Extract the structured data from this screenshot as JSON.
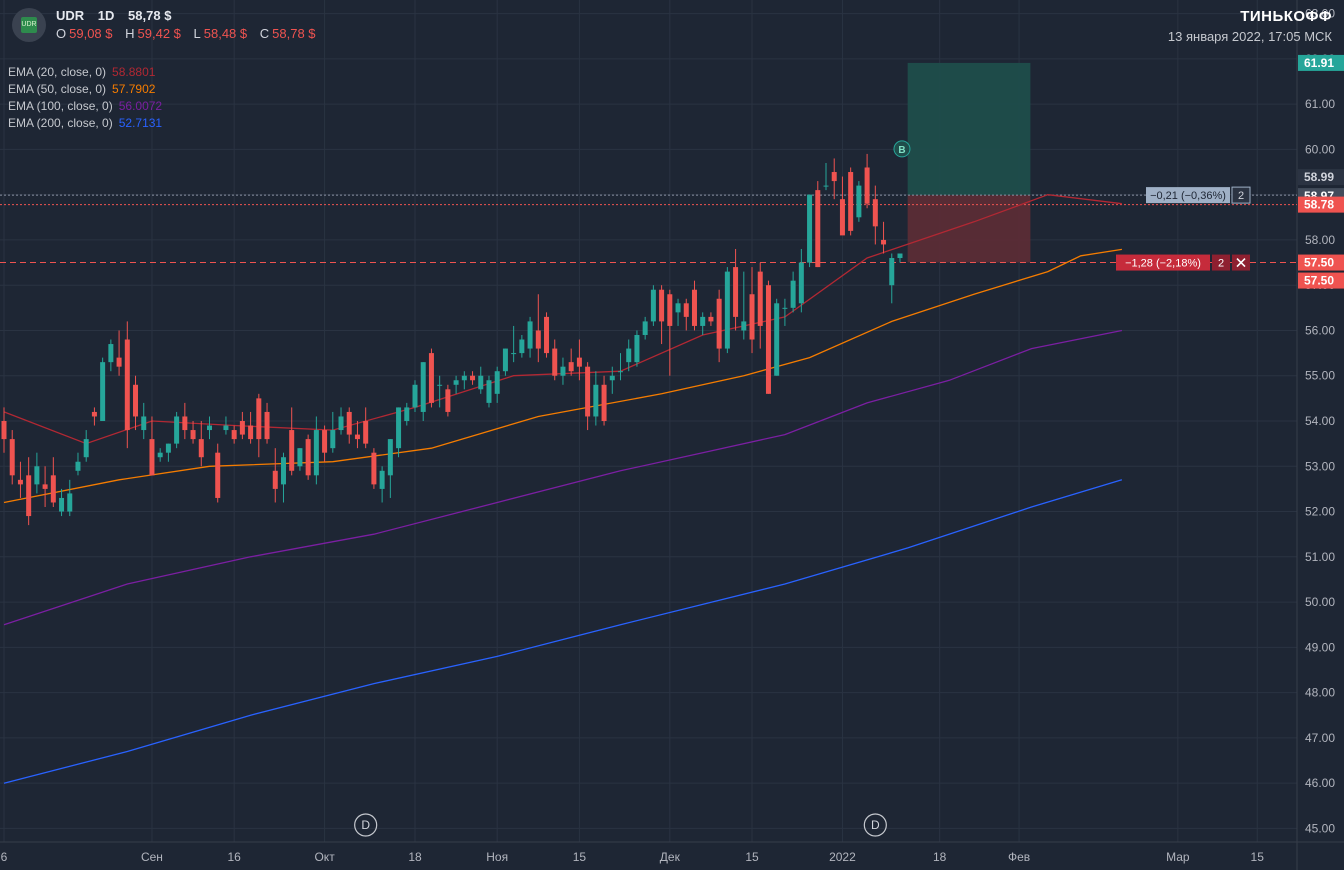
{
  "header": {
    "symbol": "UDR",
    "interval": "1D",
    "price": "58,78 $",
    "ohlc": [
      {
        "label": "O",
        "value": "59,08 $"
      },
      {
        "label": "H",
        "value": "59,42 $"
      },
      {
        "label": "L",
        "value": "58,48 $"
      },
      {
        "label": "C",
        "value": "58,78 $"
      }
    ],
    "logo_text": "UDR"
  },
  "brand": {
    "name": "ТИНЬКОФФ",
    "datetime": "13 января 2022, 17:05 МСК"
  },
  "indicators": [
    {
      "label": "EMA (20, close, 0)",
      "value": "58.8801",
      "color": "#b22833"
    },
    {
      "label": "EMA (50, close, 0)",
      "value": "57.7902",
      "color": "#f57c00"
    },
    {
      "label": "EMA (100, close, 0)",
      "value": "56.0072",
      "color": "#7b1fa2"
    },
    {
      "label": "EMA (200, close, 0)",
      "value": "52.7131",
      "color": "#2962ff"
    }
  ],
  "colors": {
    "background": "#1e2634",
    "grid": "#2a3342",
    "up": "#26a69a",
    "down": "#ef5350",
    "target_zone": "#1f4d4b",
    "stop_zone": "#5b2c36"
  },
  "chart_data": {
    "type": "candlestick",
    "ylim": [
      44.7,
      63.3
    ],
    "y_ticks": [
      "63.00",
      "62.00",
      "61.00",
      "60.00",
      "59.00",
      "58.00",
      "57.00",
      "56.00",
      "55.00",
      "54.00",
      "53.00",
      "52.00",
      "51.00",
      "50.00",
      "49.00",
      "48.00",
      "47.00",
      "46.00",
      "45.00"
    ],
    "x_ticks": [
      "6",
      "Сен",
      "16",
      "Окт",
      "18",
      "Ноя",
      "15",
      "Дек",
      "15",
      "2022",
      "18",
      "Фев",
      "Мар",
      "15"
    ],
    "x_tick_dates": [
      "2021-08-06",
      "2021-09-01",
      "2021-09-16",
      "2021-10-01",
      "2021-10-18",
      "2021-11-01",
      "2021-11-15",
      "2021-12-01",
      "2021-12-15",
      "2022-01-01",
      "2022-01-18",
      "2022-02-01",
      "2022-03-01",
      "2022-03-15"
    ],
    "candles": [
      {
        "date": "2021-08-06",
        "o": 54.0,
        "h": 54.3,
        "l": 53.3,
        "c": 53.6
      },
      {
        "date": "2021-08-09",
        "o": 53.6,
        "h": 53.8,
        "l": 52.6,
        "c": 52.8
      },
      {
        "date": "2021-08-10",
        "o": 52.7,
        "h": 53.1,
        "l": 52.3,
        "c": 52.6
      },
      {
        "date": "2021-08-11",
        "o": 52.8,
        "h": 53.2,
        "l": 51.7,
        "c": 51.9
      },
      {
        "date": "2021-08-12",
        "o": 52.6,
        "h": 53.3,
        "l": 52.4,
        "c": 53.0
      },
      {
        "date": "2021-08-13",
        "o": 52.6,
        "h": 53.0,
        "l": 52.1,
        "c": 52.5
      },
      {
        "date": "2021-08-16",
        "o": 52.8,
        "h": 53.2,
        "l": 52.1,
        "c": 52.2
      },
      {
        "date": "2021-08-17",
        "o": 52.0,
        "h": 52.5,
        "l": 51.9,
        "c": 52.3
      },
      {
        "date": "2021-08-18",
        "o": 52.0,
        "h": 52.7,
        "l": 51.9,
        "c": 52.4
      },
      {
        "date": "2021-08-19",
        "o": 52.9,
        "h": 53.3,
        "l": 52.8,
        "c": 53.1
      },
      {
        "date": "2021-08-20",
        "o": 53.2,
        "h": 53.8,
        "l": 53.1,
        "c": 53.6
      },
      {
        "date": "2021-08-23",
        "o": 54.2,
        "h": 54.3,
        "l": 53.9,
        "c": 54.1
      },
      {
        "date": "2021-08-24",
        "o": 54.0,
        "h": 55.4,
        "l": 54.0,
        "c": 55.3
      },
      {
        "date": "2021-08-25",
        "o": 55.3,
        "h": 55.8,
        "l": 55.1,
        "c": 55.7
      },
      {
        "date": "2021-08-26",
        "o": 55.4,
        "h": 56.0,
        "l": 55.0,
        "c": 55.2
      },
      {
        "date": "2021-08-27",
        "o": 55.8,
        "h": 56.2,
        "l": 53.4,
        "c": 53.8
      },
      {
        "date": "2021-08-30",
        "o": 54.8,
        "h": 55.0,
        "l": 53.8,
        "c": 54.1
      },
      {
        "date": "2021-08-31",
        "o": 53.8,
        "h": 54.4,
        "l": 53.6,
        "c": 54.1
      },
      {
        "date": "2021-09-01",
        "o": 53.6,
        "h": 54.1,
        "l": 52.8,
        "c": 52.8
      },
      {
        "date": "2021-09-02",
        "o": 53.2,
        "h": 53.4,
        "l": 53.1,
        "c": 53.3
      },
      {
        "date": "2021-09-03",
        "o": 53.3,
        "h": 53.5,
        "l": 53.1,
        "c": 53.5
      },
      {
        "date": "2021-09-07",
        "o": 53.5,
        "h": 54.2,
        "l": 53.4,
        "c": 54.1
      },
      {
        "date": "2021-09-08",
        "o": 54.1,
        "h": 54.4,
        "l": 53.6,
        "c": 53.8
      },
      {
        "date": "2021-09-09",
        "o": 53.8,
        "h": 54.0,
        "l": 53.5,
        "c": 53.6
      },
      {
        "date": "2021-09-10",
        "o": 53.6,
        "h": 54.0,
        "l": 53.0,
        "c": 53.2
      },
      {
        "date": "2021-09-13",
        "o": 53.8,
        "h": 54.1,
        "l": 53.6,
        "c": 53.9
      },
      {
        "date": "2021-09-14",
        "o": 53.3,
        "h": 53.5,
        "l": 52.2,
        "c": 52.3
      },
      {
        "date": "2021-09-15",
        "o": 53.8,
        "h": 54.1,
        "l": 53.7,
        "c": 53.9
      },
      {
        "date": "2021-09-16",
        "o": 53.8,
        "h": 53.9,
        "l": 53.5,
        "c": 53.6
      },
      {
        "date": "2021-09-17",
        "o": 54.0,
        "h": 54.2,
        "l": 53.6,
        "c": 53.7
      },
      {
        "date": "2021-09-20",
        "o": 53.9,
        "h": 54.2,
        "l": 53.5,
        "c": 53.6
      },
      {
        "date": "2021-09-21",
        "o": 54.5,
        "h": 54.6,
        "l": 53.2,
        "c": 53.6
      },
      {
        "date": "2021-09-22",
        "o": 54.2,
        "h": 54.4,
        "l": 53.5,
        "c": 53.6
      },
      {
        "date": "2021-09-23",
        "o": 52.9,
        "h": 53.4,
        "l": 52.2,
        "c": 52.5
      },
      {
        "date": "2021-09-24",
        "o": 52.6,
        "h": 53.3,
        "l": 52.2,
        "c": 53.2
      },
      {
        "date": "2021-09-27",
        "o": 53.8,
        "h": 54.3,
        "l": 52.8,
        "c": 52.9
      },
      {
        "date": "2021-09-28",
        "o": 53.0,
        "h": 53.4,
        "l": 52.9,
        "c": 53.4
      },
      {
        "date": "2021-09-29",
        "o": 53.6,
        "h": 53.7,
        "l": 52.7,
        "c": 52.8
      },
      {
        "date": "2021-09-30",
        "o": 52.8,
        "h": 54.1,
        "l": 52.6,
        "c": 53.8
      },
      {
        "date": "2021-10-01",
        "o": 53.8,
        "h": 53.9,
        "l": 53.1,
        "c": 53.3
      },
      {
        "date": "2021-10-04",
        "o": 53.4,
        "h": 54.2,
        "l": 53.3,
        "c": 53.8
      },
      {
        "date": "2021-10-05",
        "o": 53.8,
        "h": 54.3,
        "l": 53.7,
        "c": 54.1
      },
      {
        "date": "2021-10-06",
        "o": 54.2,
        "h": 54.3,
        "l": 53.5,
        "c": 53.7
      },
      {
        "date": "2021-10-07",
        "o": 53.7,
        "h": 54.0,
        "l": 53.4,
        "c": 53.6
      },
      {
        "date": "2021-10-08",
        "o": 54.0,
        "h": 54.3,
        "l": 53.4,
        "c": 53.5
      },
      {
        "date": "2021-10-11",
        "o": 53.3,
        "h": 53.4,
        "l": 52.5,
        "c": 52.6
      },
      {
        "date": "2021-10-12",
        "o": 52.5,
        "h": 53.0,
        "l": 52.2,
        "c": 52.9
      },
      {
        "date": "2021-10-13",
        "o": 52.8,
        "h": 53.6,
        "l": 52.3,
        "c": 53.6
      },
      {
        "date": "2021-10-14",
        "o": 53.4,
        "h": 54.3,
        "l": 53.2,
        "c": 54.3
      },
      {
        "date": "2021-10-15",
        "o": 54.0,
        "h": 54.4,
        "l": 53.9,
        "c": 54.3
      },
      {
        "date": "2021-10-18",
        "o": 54.3,
        "h": 54.9,
        "l": 54.2,
        "c": 54.8
      },
      {
        "date": "2021-10-19",
        "o": 54.2,
        "h": 55.3,
        "l": 54.0,
        "c": 55.3
      },
      {
        "date": "2021-10-20",
        "o": 55.5,
        "h": 55.6,
        "l": 54.3,
        "c": 54.4
      },
      {
        "date": "2021-10-21",
        "o": 54.8,
        "h": 55.0,
        "l": 54.3,
        "c": 54.8
      },
      {
        "date": "2021-10-22",
        "o": 54.7,
        "h": 54.8,
        "l": 54.1,
        "c": 54.2
      },
      {
        "date": "2021-10-25",
        "o": 54.8,
        "h": 55.0,
        "l": 54.6,
        "c": 54.9
      },
      {
        "date": "2021-10-26",
        "o": 54.9,
        "h": 55.1,
        "l": 54.7,
        "c": 55.0
      },
      {
        "date": "2021-10-27",
        "o": 55.0,
        "h": 55.1,
        "l": 54.8,
        "c": 54.9
      },
      {
        "date": "2021-10-28",
        "o": 54.7,
        "h": 55.2,
        "l": 54.6,
        "c": 55.0
      },
      {
        "date": "2021-10-29",
        "o": 54.4,
        "h": 55.0,
        "l": 54.3,
        "c": 54.9
      },
      {
        "date": "2021-11-01",
        "o": 54.6,
        "h": 55.2,
        "l": 54.4,
        "c": 55.1
      },
      {
        "date": "2021-11-02",
        "o": 55.1,
        "h": 55.6,
        "l": 55.0,
        "c": 55.6
      },
      {
        "date": "2021-11-03",
        "o": 55.5,
        "h": 56.1,
        "l": 55.3,
        "c": 55.5
      },
      {
        "date": "2021-11-04",
        "o": 55.5,
        "h": 55.9,
        "l": 55.4,
        "c": 55.8
      },
      {
        "date": "2021-11-05",
        "o": 55.6,
        "h": 56.3,
        "l": 55.4,
        "c": 56.2
      },
      {
        "date": "2021-11-08",
        "o": 56.0,
        "h": 56.8,
        "l": 55.3,
        "c": 55.6
      },
      {
        "date": "2021-11-09",
        "o": 56.3,
        "h": 56.4,
        "l": 55.4,
        "c": 55.5
      },
      {
        "date": "2021-11-10",
        "o": 55.6,
        "h": 55.8,
        "l": 54.9,
        "c": 55.0
      },
      {
        "date": "2021-11-11",
        "o": 55.0,
        "h": 55.4,
        "l": 54.8,
        "c": 55.2
      },
      {
        "date": "2021-11-12",
        "o": 55.3,
        "h": 55.6,
        "l": 55.0,
        "c": 55.1
      },
      {
        "date": "2021-11-15",
        "o": 55.4,
        "h": 55.8,
        "l": 54.9,
        "c": 55.2
      },
      {
        "date": "2021-11-16",
        "o": 55.2,
        "h": 55.3,
        "l": 53.8,
        "c": 54.1
      },
      {
        "date": "2021-11-17",
        "o": 54.1,
        "h": 55.1,
        "l": 53.9,
        "c": 54.8
      },
      {
        "date": "2021-11-18",
        "o": 54.8,
        "h": 55.0,
        "l": 53.9,
        "c": 54.0
      },
      {
        "date": "2021-11-19",
        "o": 54.9,
        "h": 55.2,
        "l": 54.6,
        "c": 55.0
      },
      {
        "date": "2021-11-22",
        "o": 55.1,
        "h": 55.5,
        "l": 54.9,
        "c": 55.1
      },
      {
        "date": "2021-11-23",
        "o": 55.3,
        "h": 55.8,
        "l": 55.1,
        "c": 55.6
      },
      {
        "date": "2021-11-24",
        "o": 55.3,
        "h": 56.0,
        "l": 55.2,
        "c": 55.9
      },
      {
        "date": "2021-11-26",
        "o": 55.9,
        "h": 56.3,
        "l": 55.8,
        "c": 56.2
      },
      {
        "date": "2021-11-29",
        "o": 56.2,
        "h": 57.0,
        "l": 56.1,
        "c": 56.9
      },
      {
        "date": "2021-11-30",
        "o": 56.9,
        "h": 57.0,
        "l": 55.7,
        "c": 56.2
      },
      {
        "date": "2021-12-01",
        "o": 56.8,
        "h": 56.9,
        "l": 55.0,
        "c": 56.1
      },
      {
        "date": "2021-12-02",
        "o": 56.4,
        "h": 56.7,
        "l": 56.1,
        "c": 56.6
      },
      {
        "date": "2021-12-03",
        "o": 56.6,
        "h": 56.7,
        "l": 56.0,
        "c": 56.3
      },
      {
        "date": "2021-12-06",
        "o": 56.9,
        "h": 57.1,
        "l": 56.0,
        "c": 56.1
      },
      {
        "date": "2021-12-07",
        "o": 56.1,
        "h": 56.4,
        "l": 55.9,
        "c": 56.3
      },
      {
        "date": "2021-12-08",
        "o": 56.3,
        "h": 56.4,
        "l": 56.1,
        "c": 56.2
      },
      {
        "date": "2021-12-09",
        "o": 56.7,
        "h": 56.9,
        "l": 55.3,
        "c": 55.6
      },
      {
        "date": "2021-12-10",
        "o": 55.6,
        "h": 57.4,
        "l": 55.5,
        "c": 57.3
      },
      {
        "date": "2021-12-13",
        "o": 57.4,
        "h": 57.8,
        "l": 56.0,
        "c": 56.3
      },
      {
        "date": "2021-12-14",
        "o": 56.0,
        "h": 57.3,
        "l": 55.8,
        "c": 56.2
      },
      {
        "date": "2021-12-15",
        "o": 56.8,
        "h": 57.4,
        "l": 55.5,
        "c": 55.8
      },
      {
        "date": "2021-12-16",
        "o": 57.3,
        "h": 57.5,
        "l": 55.6,
        "c": 56.1
      },
      {
        "date": "2021-12-17",
        "o": 57.0,
        "h": 57.1,
        "l": 54.6,
        "c": 54.6
      },
      {
        "date": "2021-12-20",
        "o": 55.0,
        "h": 56.7,
        "l": 55.0,
        "c": 56.6
      },
      {
        "date": "2021-12-21",
        "o": 56.5,
        "h": 56.7,
        "l": 56.1,
        "c": 56.5
      },
      {
        "date": "2021-12-22",
        "o": 56.5,
        "h": 57.3,
        "l": 56.4,
        "c": 57.1
      },
      {
        "date": "2021-12-23",
        "o": 56.6,
        "h": 57.8,
        "l": 56.4,
        "c": 57.5
      },
      {
        "date": "2021-12-27",
        "o": 57.5,
        "h": 59.0,
        "l": 57.4,
        "c": 59.0
      },
      {
        "date": "2021-12-28",
        "o": 59.1,
        "h": 59.3,
        "l": 57.4,
        "c": 57.4
      },
      {
        "date": "2021-12-29",
        "o": 59.2,
        "h": 59.7,
        "l": 59.1,
        "c": 59.2
      },
      {
        "date": "2021-12-30",
        "o": 59.5,
        "h": 59.8,
        "l": 58.9,
        "c": 59.3
      },
      {
        "date": "2021-12-31",
        "o": 58.9,
        "h": 59.4,
        "l": 58.2,
        "c": 58.1
      },
      {
        "date": "2022-01-03",
        "o": 59.5,
        "h": 59.6,
        "l": 58.1,
        "c": 58.2
      },
      {
        "date": "2022-01-04",
        "o": 58.5,
        "h": 59.3,
        "l": 58.4,
        "c": 59.2
      },
      {
        "date": "2022-01-05",
        "o": 59.6,
        "h": 59.9,
        "l": 58.7,
        "c": 58.8
      },
      {
        "date": "2022-01-06",
        "o": 58.9,
        "h": 59.2,
        "l": 57.9,
        "c": 58.3
      },
      {
        "date": "2022-01-07",
        "o": 58.0,
        "h": 58.4,
        "l": 57.7,
        "c": 57.9
      },
      {
        "date": "2022-01-10",
        "o": 57.0,
        "h": 57.7,
        "l": 56.6,
        "c": 57.6
      },
      {
        "date": "2022-01-11",
        "o": 57.6,
        "h": 57.7,
        "l": 57.5,
        "c": 57.7
      }
    ],
    "ema": [
      {
        "name": "EMA 20",
        "color": "#b22833",
        "values": [
          [
            0,
            54.2
          ],
          [
            10,
            53.5
          ],
          [
            18,
            54.0
          ],
          [
            28,
            53.9
          ],
          [
            40,
            53.8
          ],
          [
            50,
            54.3
          ],
          [
            62,
            55.0
          ],
          [
            75,
            55.1
          ],
          [
            85,
            55.9
          ],
          [
            95,
            56.3
          ],
          [
            105,
            57.6
          ],
          [
            118,
            58.4
          ],
          [
            127,
            59.0
          ],
          [
            136,
            58.8
          ]
        ]
      },
      {
        "name": "EMA 50",
        "color": "#f57c00",
        "values": [
          [
            0,
            52.2
          ],
          [
            14,
            52.7
          ],
          [
            25,
            53.0
          ],
          [
            40,
            53.1
          ],
          [
            52,
            53.4
          ],
          [
            65,
            54.1
          ],
          [
            80,
            54.6
          ],
          [
            90,
            55.0
          ],
          [
            98,
            55.4
          ],
          [
            108,
            56.2
          ],
          [
            118,
            56.8
          ],
          [
            127,
            57.3
          ],
          [
            131,
            57.65
          ],
          [
            136,
            57.79
          ]
        ]
      },
      {
        "name": "EMA 100",
        "color": "#7b1fa2",
        "values": [
          [
            0,
            49.5
          ],
          [
            15,
            50.4
          ],
          [
            30,
            51.0
          ],
          [
            45,
            51.5
          ],
          [
            60,
            52.2
          ],
          [
            75,
            52.9
          ],
          [
            85,
            53.3
          ],
          [
            95,
            53.7
          ],
          [
            105,
            54.4
          ],
          [
            115,
            54.9
          ],
          [
            125,
            55.6
          ],
          [
            136,
            56.0
          ]
        ]
      },
      {
        "name": "EMA 200",
        "color": "#2962ff",
        "values": [
          [
            0,
            46.0
          ],
          [
            15,
            46.7
          ],
          [
            30,
            47.5
          ],
          [
            45,
            48.2
          ],
          [
            60,
            48.8
          ],
          [
            75,
            49.5
          ],
          [
            95,
            50.4
          ],
          [
            110,
            51.2
          ],
          [
            125,
            52.1
          ],
          [
            136,
            52.7
          ]
        ]
      }
    ],
    "position": {
      "entry": 58.99,
      "target": 61.91,
      "stop": 57.5,
      "current": 58.78,
      "entry_label": "58.97",
      "pnl_label": "−0,21 (−0,36%)",
      "stop_pnl_label": "−1,28 (−2,18%)",
      "qty": "2",
      "marker": "B"
    },
    "price_labels": [
      "61.91",
      "58.99",
      "58.97",
      "58.78",
      "57.50",
      "57.50"
    ],
    "dividend_markers": [
      "D",
      "D"
    ],
    "dividend_dates": [
      "2021-10-08",
      "2022-01-06"
    ]
  }
}
